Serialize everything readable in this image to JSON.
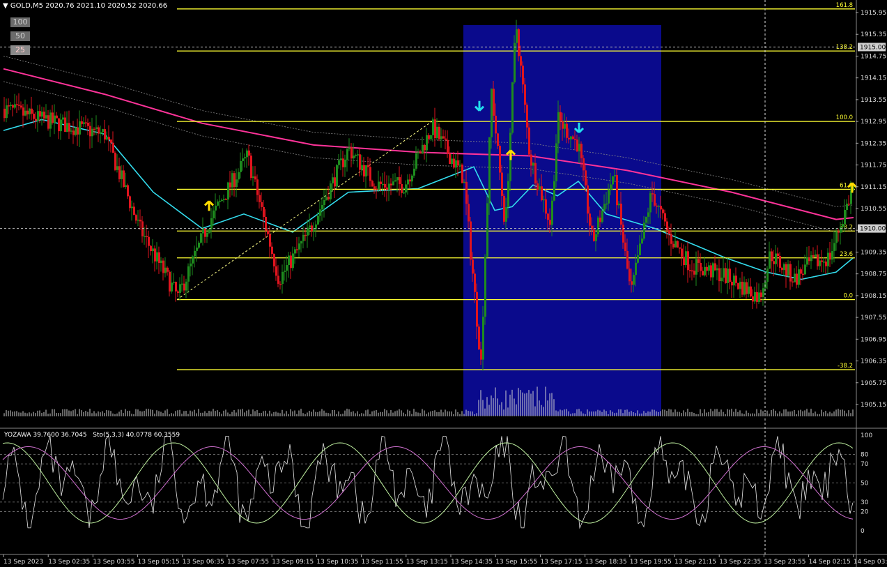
{
  "header": {
    "symbol_info": "GOLD,M5",
    "ohlc": "2020.76 2021.10 2020.52 2020.66",
    "menu_icon": "triangle-down-icon"
  },
  "scale_buttons": [
    "100",
    "50",
    "25"
  ],
  "indicator_header": {
    "yozawa": "YOZAWA 39.7600 36.7045",
    "stochastic": "Sto(5,3,3) 40.0778 60.3559"
  },
  "price_axis_labels": [
    "1915.95",
    "1915.35",
    "1914.75",
    "1914.15",
    "1913.55",
    "1912.95",
    "1912.35",
    "1911.75",
    "1911.15",
    "1910.55",
    "1909.95",
    "1909.35",
    "1908.75",
    "1908.15",
    "1907.55",
    "1906.95",
    "1906.35",
    "1905.75",
    "1905.15"
  ],
  "price_markers": [
    "1915.00",
    "1910.00"
  ],
  "osc_axis_labels": [
    "100",
    "80",
    "70",
    "50",
    "30",
    "20",
    "0"
  ],
  "fib_levels": [
    {
      "label": "161.8",
      "price": 1916.05
    },
    {
      "label": "138.2",
      "price": 1914.89
    },
    {
      "label": "100.0",
      "price": 1912.95
    },
    {
      "label": "61.8",
      "price": 1911.08
    },
    {
      "label": "38.2",
      "price": 1909.93
    },
    {
      "label": "23.6",
      "price": 1909.19
    },
    {
      "label": "0.0",
      "price": 1908.04
    },
    {
      "label": "-38.2",
      "price": 1906.11
    }
  ],
  "time_labels": [
    "13 Sep 2023",
    "13 Sep 02:35",
    "13 Sep 03:55",
    "13 Sep 05:15",
    "13 Sep 06:35",
    "13 Sep 07:55",
    "13 Sep 09:15",
    "13 Sep 10:35",
    "13 Sep 11:55",
    "13 Sep 13:15",
    "13 Sep 14:35",
    "13 Sep 15:55",
    "13 Sep 17:15",
    "13 Sep 18:35",
    "13 Sep 19:55",
    "13 Sep 21:15",
    "13 Sep 22:35",
    "13 Sep 23:55",
    "14 Sep 02:15",
    "14 Sep 03:35"
  ],
  "colors": {
    "background": "#000000",
    "bull": "#1e8c1e",
    "bear": "#e0141e",
    "fib": "#ffff33",
    "ma_slow": "#ff3399",
    "ma_fast": "#33ddee",
    "highlight_box": "#0a0a8c",
    "arrow_up": "#ffdd00",
    "arrow_down": "#22ddee"
  },
  "arrows": [
    {
      "type": "up",
      "icon": "arrow-up-icon"
    },
    {
      "type": "down",
      "icon": "arrow-down-icon"
    },
    {
      "type": "up",
      "icon": "arrow-up-icon"
    },
    {
      "type": "down",
      "icon": "arrow-down-icon"
    },
    {
      "type": "up",
      "icon": "arrow-up-icon"
    }
  ]
}
